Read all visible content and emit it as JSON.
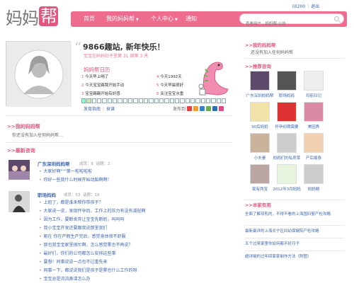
{
  "brand": {
    "logo_part1": "妈妈",
    "logo_part2": "帮"
  },
  "topbar": {
    "user": "lili200",
    "logout": "退出"
  },
  "nav": {
    "items": [
      {
        "label": "首页"
      },
      {
        "label": "我的妈妈帮",
        "has_caret": true
      },
      {
        "label": "个人中心",
        "has_caret": true
      },
      {
        "label": "通知"
      }
    ],
    "search_placeholder": "查看用户、妈妈帮-公告",
    "accent_color": "#ee6d8e"
  },
  "profile": {
    "headline": "9866趣站, 新年快乐！",
    "subline_prefix": "宝宝在妈妈肚子里第",
    "weeks": "31",
    "weeks_unit": "周第",
    "days": "3",
    "days_unit": "天",
    "diary_title": "妈妈帮日历",
    "notes": [
      "今天早上喝了",
      "今天1992天",
      "今天宝宝踢我开始手动",
      "今天早晨很好",
      "宝宝踢踢开始有好感",
      "关注宝宝水重"
    ],
    "links": [
      "发育指南",
      "食谱"
    ],
    "share_label": "发布到"
  },
  "my_groups": {
    "title": "我的妈妈帮",
    "empty_text": "你还没有加入任何妈妈帮…"
  },
  "latest": {
    "title": "最新咨询",
    "groups": [
      {
        "name": "广东深圳妈妈帮",
        "members_label": "成员：",
        "members": "6",
        "topics_label": "话题：",
        "topics": "2",
        "posts": [
          "大家好啊\"\"\"第一啦啦啦啦",
          "你好一些我什么时候开始动胎啊啊！"
        ]
      },
      {
        "name": "职场妈妈",
        "members_label": "成员：",
        "members": "53",
        "topics_label": "话题：",
        "topics": "19",
        "posts": [
          "上班了，都是谁来帮你带孩子？",
          "大家说一说，发现怀孕后，工作上的压力有没有减轻啊",
          "因为工作，要断舍弃让宝宝先断奶，吗吗吗",
          "我小宝宝开发还要跟我说那里我们",
          "刚在 你在产假生产完后，感觉身体很不舒服",
          "那也我宝宝家里很忙啊，怎么感觉累也不再说？",
          "最好们，你们的公司都怎么安排这些事",
          "要想！同事说说一点也不过重先来",
          "同事一下，都说说我们是孩子是累也什么工作的呀",
          "宝宝总是流流鼻涕怎么办",
          "想怀孕的时候了，能怎么调整吗？"
        ]
      }
    ]
  },
  "right": {
    "my_groups_title": "我的妈妈帮",
    "my_groups_text": "还没有加入任何妈妈帮",
    "recommend_title": "推荐咨询",
    "tiles": [
      {
        "label": "广东深圳妈妈帮"
      },
      {
        "label": "职场妈妈"
      },
      {
        "label": "玛丽日记"
      },
      {
        "label": "90后妈妈"
      },
      {
        "label": "怀孕初期需要"
      },
      {
        "label": "美因秀"
      },
      {
        "label": "小夫妻"
      },
      {
        "label": "妈妈们的私房菜"
      },
      {
        "label": "产后瘦身"
      },
      {
        "label": "家有两宝"
      },
      {
        "label": "2012年3月妈妈"
      },
      {
        "label": "妈妈精"
      }
    ],
    "hot_title": "本家有用",
    "hot_items": [
      "全面了解母乳的，不得不看的上海国妇婴产检攻略",
      "最新最详的上海长宁区妇幼保健院产检攻略",
      "五个过来家里你如何都不好月子",
      "超详细的过年回家家制作方法（附图）"
    ]
  }
}
